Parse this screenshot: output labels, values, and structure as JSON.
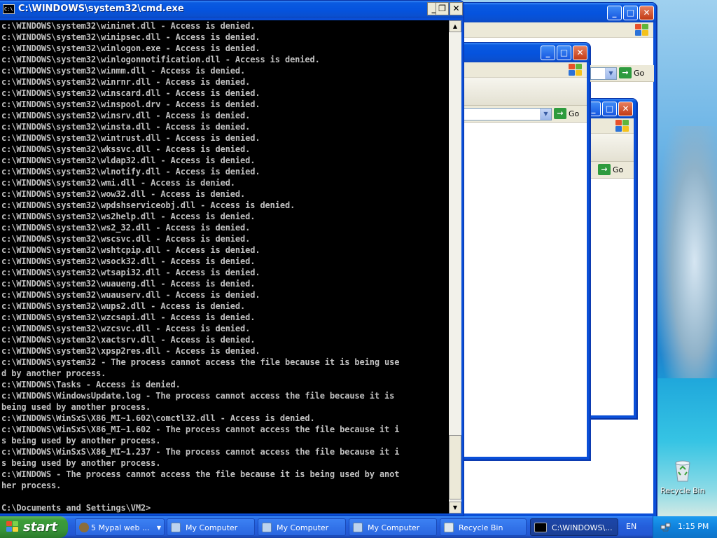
{
  "cmd_window": {
    "title": "C:\\WINDOWS\\system32\\cmd.exe",
    "icon_text": "C:\\",
    "lines": [
      "c:\\WINDOWS\\system32\\wininet.dll - Access is denied.",
      "c:\\WINDOWS\\system32\\winipsec.dll - Access is denied.",
      "c:\\WINDOWS\\system32\\winlogon.exe - Access is denied.",
      "c:\\WINDOWS\\system32\\winlogonnotification.dll - Access is denied.",
      "c:\\WINDOWS\\system32\\winmm.dll - Access is denied.",
      "c:\\WINDOWS\\system32\\winrnr.dll - Access is denied.",
      "c:\\WINDOWS\\system32\\winscard.dll - Access is denied.",
      "c:\\WINDOWS\\system32\\winspool.drv - Access is denied.",
      "c:\\WINDOWS\\system32\\winsrv.dll - Access is denied.",
      "c:\\WINDOWS\\system32\\winsta.dll - Access is denied.",
      "c:\\WINDOWS\\system32\\wintrust.dll - Access is denied.",
      "c:\\WINDOWS\\system32\\wkssvc.dll - Access is denied.",
      "c:\\WINDOWS\\system32\\wldap32.dll - Access is denied.",
      "c:\\WINDOWS\\system32\\wlnotify.dll - Access is denied.",
      "c:\\WINDOWS\\system32\\wmi.dll - Access is denied.",
      "c:\\WINDOWS\\system32\\wow32.dll - Access is denied.",
      "c:\\WINDOWS\\system32\\wpdshserviceobj.dll - Access is denied.",
      "c:\\WINDOWS\\system32\\ws2help.dll - Access is denied.",
      "c:\\WINDOWS\\system32\\ws2_32.dll - Access is denied.",
      "c:\\WINDOWS\\system32\\wscsvc.dll - Access is denied.",
      "c:\\WINDOWS\\system32\\wshtcpip.dll - Access is denied.",
      "c:\\WINDOWS\\system32\\wsock32.dll - Access is denied.",
      "c:\\WINDOWS\\system32\\wtsapi32.dll - Access is denied.",
      "c:\\WINDOWS\\system32\\wuaueng.dll - Access is denied.",
      "c:\\WINDOWS\\system32\\wuauserv.dll - Access is denied.",
      "c:\\WINDOWS\\system32\\wups2.dll - Access is denied.",
      "c:\\WINDOWS\\system32\\wzcsapi.dll - Access is denied.",
      "c:\\WINDOWS\\system32\\wzcsvc.dll - Access is denied.",
      "c:\\WINDOWS\\system32\\xactsrv.dll - Access is denied.",
      "c:\\WINDOWS\\system32\\xpsp2res.dll - Access is denied.",
      "c:\\WINDOWS\\system32 - The process cannot access the file because it is being use",
      "d by another process.",
      "c:\\WINDOWS\\Tasks - Access is denied.",
      "c:\\WINDOWS\\WindowsUpdate.log - The process cannot access the file because it is",
      "being used by another process.",
      "c:\\WINDOWS\\WinSxS\\X86_MI~1.602\\comctl32.dll - Access is denied.",
      "c:\\WINDOWS\\WinSxS\\X86_MI~1.602 - The process cannot access the file because it i",
      "s being used by another process.",
      "c:\\WINDOWS\\WinSxS\\X86_MI~1.237 - The process cannot access the file because it i",
      "s being used by another process.",
      "c:\\WINDOWS - The process cannot access the file because it is being used by anot",
      "her process.",
      "",
      "C:\\Documents and Settings\\VM2>"
    ]
  },
  "explorer_windows": {
    "go_label": "Go",
    "count": 3
  },
  "desktop": {
    "recycle_bin_label": "Recycle Bin"
  },
  "taskbar": {
    "start_label": "start",
    "items": [
      {
        "label": "5 Mypal web ...",
        "icon": "browser-icon",
        "has_dropdown": true
      },
      {
        "label": "My Computer",
        "icon": "computer-icon"
      },
      {
        "label": "My Computer",
        "icon": "computer-icon"
      },
      {
        "label": "My Computer",
        "icon": "computer-icon"
      },
      {
        "label": "Recycle Bin",
        "icon": "recycle-bin-icon"
      },
      {
        "label": "C:\\WINDOWS\\...",
        "icon": "cmd-icon",
        "active": true
      }
    ],
    "language": "EN",
    "clock": "1:15 PM"
  },
  "colors": {
    "titlebar_blue": "#0a5ae0",
    "taskbar_blue": "#245edb",
    "start_green": "#3c9c37",
    "console_bg": "#000000",
    "console_text": "#c0c0c0",
    "close_red": "#c23a14"
  }
}
